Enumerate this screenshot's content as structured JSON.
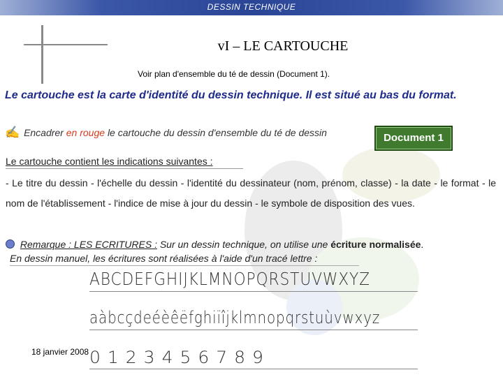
{
  "header": {
    "title": "DESSIN TECHNIQUE"
  },
  "slide": {
    "title": "vI – LE CARTOUCHE",
    "subtitle": "Voir plan d'ensemble du té de dessin (Document 1).",
    "intro": "Le cartouche est la carte d'identité du dessin technique. Il est situé au bas du format.",
    "task": {
      "icon": "pen-icon",
      "prefix": "Encadrer",
      "highlight": "en rouge",
      "rest": "le cartouche du dessin d'ensemble du té de dessin"
    },
    "doc_button": "Document 1",
    "lead": "Le cartouche contient les indications suivantes :",
    "list": "- Le titre du dessin - l'échelle du dessin - l'identité du dessinateur (nom, prénom, classe) - la date - le format - le nom de l'établissement - l'indice de mise à jour du dessin - le symbole de disposition des vues.",
    "remark": {
      "label": "Remarque : LES ECRITURES :",
      "text": "Sur un dessin technique, on utilise une",
      "bold": "écriture normalisée",
      "end": ".",
      "line2": "En dessin manuel, les écritures sont réalisées à l'aide d'un tracé lettre :"
    },
    "lettering": {
      "uppercase": "ABCDEFGHIJKLMNOPQRSTUVWXYZ",
      "lowercase": "aàbcçdeéèêëfghiïîjklmnopqrstuùvwxyz",
      "digits": "0 1 2 3 4 5 6 7 8 9"
    },
    "date": "18 janvier 2008"
  },
  "colors": {
    "header_bg": "#2a4595",
    "intro_text": "#1f2b8a",
    "highlight_red": "#d93a1f",
    "button_bg": "#3f7a2e"
  }
}
